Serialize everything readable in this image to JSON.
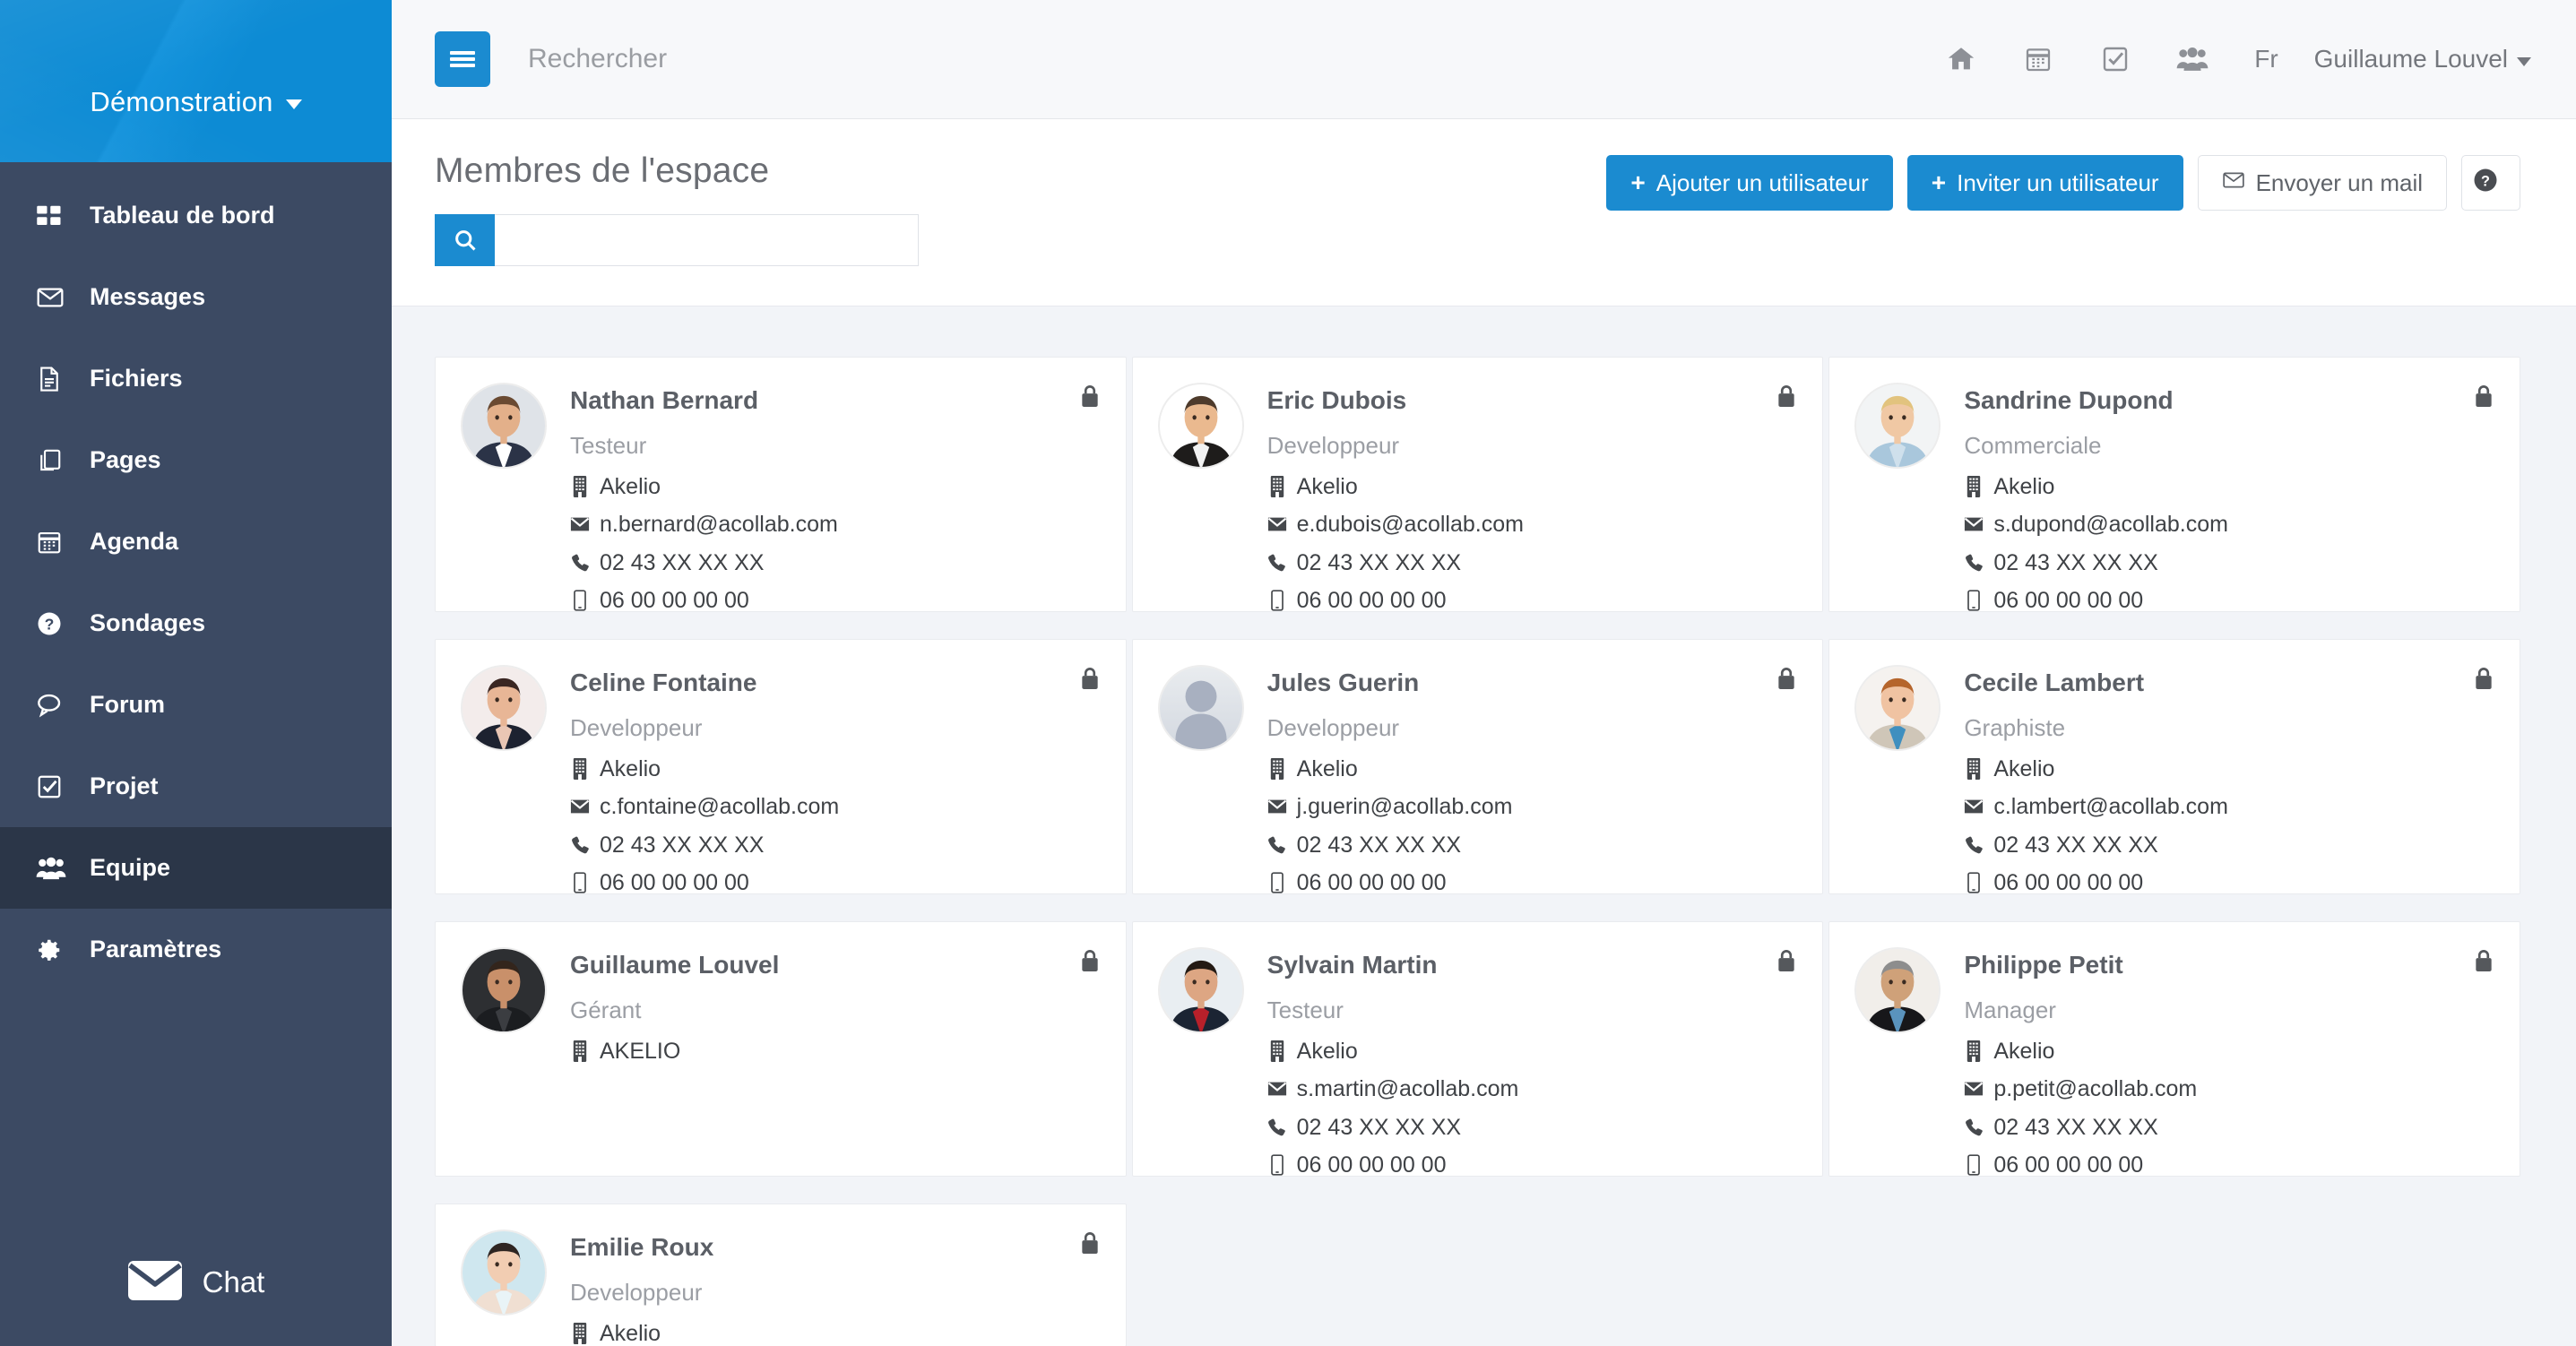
{
  "sidebar": {
    "brand": {
      "name": "Démonstration",
      "caret_icon": "chevron-down-icon"
    },
    "items": [
      {
        "label": "Tableau de bord",
        "icon": "dashboard-grid-icon",
        "active": false
      },
      {
        "label": "Messages",
        "icon": "envelope-icon",
        "active": false
      },
      {
        "label": "Fichiers",
        "icon": "file-text-icon",
        "active": false
      },
      {
        "label": "Pages",
        "icon": "copy-pages-icon",
        "active": false
      },
      {
        "label": "Agenda",
        "icon": "calendar-icon",
        "active": false
      },
      {
        "label": "Sondages",
        "icon": "question-circle-icon",
        "active": false
      },
      {
        "label": "Forum",
        "icon": "comment-bubble-icon",
        "active": false
      },
      {
        "label": "Projet",
        "icon": "check-square-icon",
        "active": false
      },
      {
        "label": "Equipe",
        "icon": "users-group-icon",
        "active": true
      },
      {
        "label": "Paramètres",
        "icon": "gear-icon",
        "active": false
      }
    ],
    "chat": {
      "label": "Chat",
      "icon": "envelope-solid-icon"
    }
  },
  "topbar": {
    "menu_toggle_icon": "hamburger-menu-icon",
    "search_placeholder": "Rechercher",
    "search_value": "",
    "icons": [
      {
        "name": "home-icon",
        "title": "Accueil"
      },
      {
        "name": "calendar-icon",
        "title": "Agenda"
      },
      {
        "name": "check-square-icon",
        "title": "Tâches"
      },
      {
        "name": "users-group-icon",
        "title": "Equipe"
      }
    ],
    "language": "Fr",
    "user_name": "Guillaume Louvel",
    "user_caret_icon": "chevron-down-icon"
  },
  "page": {
    "title": "Membres de l'espace",
    "search": {
      "placeholder": "",
      "value": "",
      "icon": "search-icon"
    },
    "actions": [
      {
        "label": "Ajouter un utilisateur",
        "icon": "plus-icon",
        "style": "primary"
      },
      {
        "label": "Inviter un utilisateur",
        "icon": "plus-icon",
        "style": "primary"
      },
      {
        "label": "Envoyer un mail",
        "icon": "envelope-icon",
        "style": "default"
      },
      {
        "label": "",
        "icon": "help-circle-icon",
        "style": "default"
      }
    ]
  },
  "colors": {
    "brand_blue": "#0d8bd4",
    "accent_blue": "#1b8bd0",
    "sidebar_bg": "#3c4a63",
    "sidebar_active": "#2b3648",
    "content_bg": "#f2f4f8",
    "card_bg": "#ffffff"
  },
  "members": [
    {
      "name": "Nathan Bernard",
      "role": "Testeur",
      "company": "Akelio",
      "email": "n.bernard@acollab.com",
      "phone": "02 43 XX XX XX",
      "mobile": "06 00 00 00 00",
      "avatar": "photo-man-suit",
      "lock_icon": "lock-icon"
    },
    {
      "name": "Eric Dubois",
      "role": "Developpeur",
      "company": "Akelio",
      "email": "e.dubois@acollab.com",
      "phone": "02 43 XX XX XX",
      "mobile": "06 00 00 00 00",
      "avatar": "photo-man-hand",
      "lock_icon": "lock-icon"
    },
    {
      "name": "Sandrine Dupond",
      "role": "Commerciale",
      "company": "Akelio",
      "email": "s.dupond@acollab.com",
      "phone": "02 43 XX XX XX",
      "mobile": "06 00 00 00 00",
      "avatar": "photo-woman-blonde",
      "lock_icon": "lock-icon"
    },
    {
      "name": "Celine Fontaine",
      "role": "Developpeur",
      "company": "Akelio",
      "email": "c.fontaine@acollab.com",
      "phone": "02 43 XX XX XX",
      "mobile": "06 00 00 00 00",
      "avatar": "photo-woman-dark",
      "lock_icon": "lock-icon"
    },
    {
      "name": "Jules Guerin",
      "role": "Developpeur",
      "company": "Akelio",
      "email": "j.guerin@acollab.com",
      "phone": "02 43 XX XX XX",
      "mobile": "06 00 00 00 00",
      "avatar": "placeholder-silhouette",
      "lock_icon": "lock-icon"
    },
    {
      "name": "Cecile Lambert",
      "role": "Graphiste",
      "company": "Akelio",
      "email": "c.lambert@acollab.com",
      "phone": "02 43 XX XX XX",
      "mobile": "06 00 00 00 00",
      "avatar": "photo-woman-redhead",
      "lock_icon": "lock-icon"
    },
    {
      "name": "Guillaume Louvel",
      "role": "Gérant",
      "company": "AKELIO",
      "email": "",
      "phone": "",
      "mobile": "",
      "avatar": "photo-man-dark",
      "lock_icon": "lock-icon"
    },
    {
      "name": "Sylvain Martin",
      "role": "Testeur",
      "company": "Akelio",
      "email": "s.martin@acollab.com",
      "phone": "02 43 XX XX XX",
      "mobile": "06 00 00 00 00",
      "avatar": "photo-man-tie",
      "lock_icon": "lock-icon"
    },
    {
      "name": "Philippe Petit",
      "role": "Manager",
      "company": "Akelio",
      "email": "p.petit@acollab.com",
      "phone": "02 43 XX XX XX",
      "mobile": "06 00 00 00 00",
      "avatar": "photo-man-glasses",
      "lock_icon": "lock-icon"
    },
    {
      "name": "Emilie Roux",
      "role": "Developpeur",
      "company": "Akelio",
      "email": "",
      "phone": "",
      "mobile": "",
      "avatar": "photo-woman-beach",
      "lock_icon": "lock-icon"
    }
  ],
  "icon_glyphs": {
    "building": "🏢",
    "envelope": "✉",
    "phone": "✆",
    "mobile": "▯"
  }
}
